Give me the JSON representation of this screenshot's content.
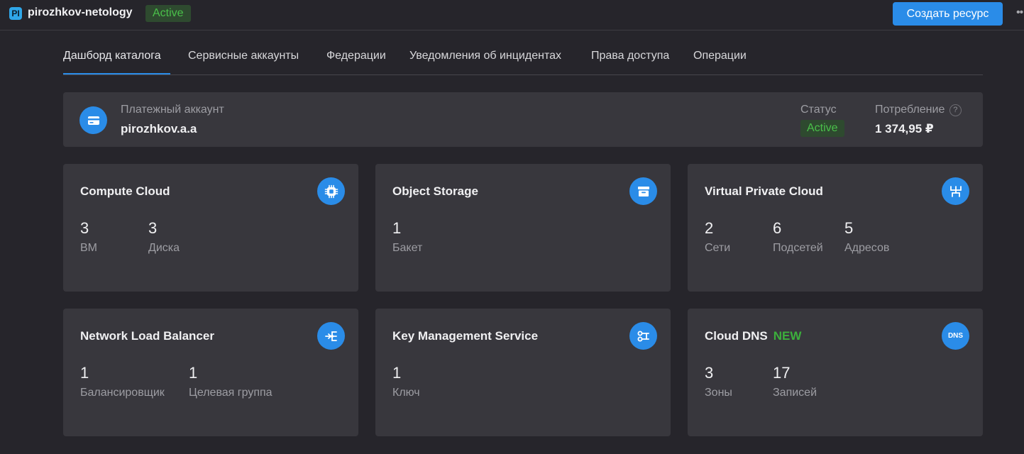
{
  "header": {
    "logo_letters": "PI",
    "cloud_name": "pirozhkov-netology",
    "status": "Active",
    "create_button": "Создать ресурс",
    "more": "••"
  },
  "tabs": [
    {
      "label": "Дашборд каталога",
      "active": true
    },
    {
      "label": "Сервисные аккаунты"
    },
    {
      "label": "Федерации"
    },
    {
      "label": "Уведомления об инцидентах"
    },
    {
      "label": "Права доступа"
    },
    {
      "label": "Операции"
    }
  ],
  "billing": {
    "label": "Платежный аккаунт",
    "name": "pirozhkov.a.a",
    "status_label": "Статус",
    "status": "Active",
    "consumption_label": "Потребление",
    "help": "?",
    "consumption_value": "1 374,95 ₽"
  },
  "cards": [
    {
      "title": "Compute Cloud",
      "icon": "chip-icon",
      "metrics": [
        {
          "value": "3",
          "label": "ВМ"
        },
        {
          "value": "3",
          "label": "Диска"
        }
      ]
    },
    {
      "title": "Object Storage",
      "icon": "storage-icon",
      "metrics": [
        {
          "value": "1",
          "label": "Бакет"
        }
      ]
    },
    {
      "title": "Virtual Private Cloud",
      "icon": "network-icon",
      "metrics": [
        {
          "value": "2",
          "label": "Сети"
        },
        {
          "value": "6",
          "label": "Подсетей"
        },
        {
          "value": "5",
          "label": "Адресов"
        }
      ]
    },
    {
      "title": "Network Load Balancer",
      "icon": "balancer-icon",
      "metrics": [
        {
          "value": "1",
          "label": "Балансировщик"
        },
        {
          "value": "1",
          "label": "Целевая группа"
        }
      ]
    },
    {
      "title": "Key Management Service",
      "icon": "key-icon",
      "metrics": [
        {
          "value": "1",
          "label": "Ключ"
        }
      ]
    },
    {
      "title": "Cloud DNS",
      "badge": "NEW",
      "icon": "dns-icon",
      "icon_text": "DNS",
      "metrics": [
        {
          "value": "3",
          "label": "Зоны"
        },
        {
          "value": "17",
          "label": "Записей"
        }
      ]
    }
  ],
  "colors": {
    "accent": "#2a8ce8",
    "status_green": "#4ac04a",
    "new_green": "#3cb03c",
    "background": "#26252b",
    "card": "#38373d"
  }
}
